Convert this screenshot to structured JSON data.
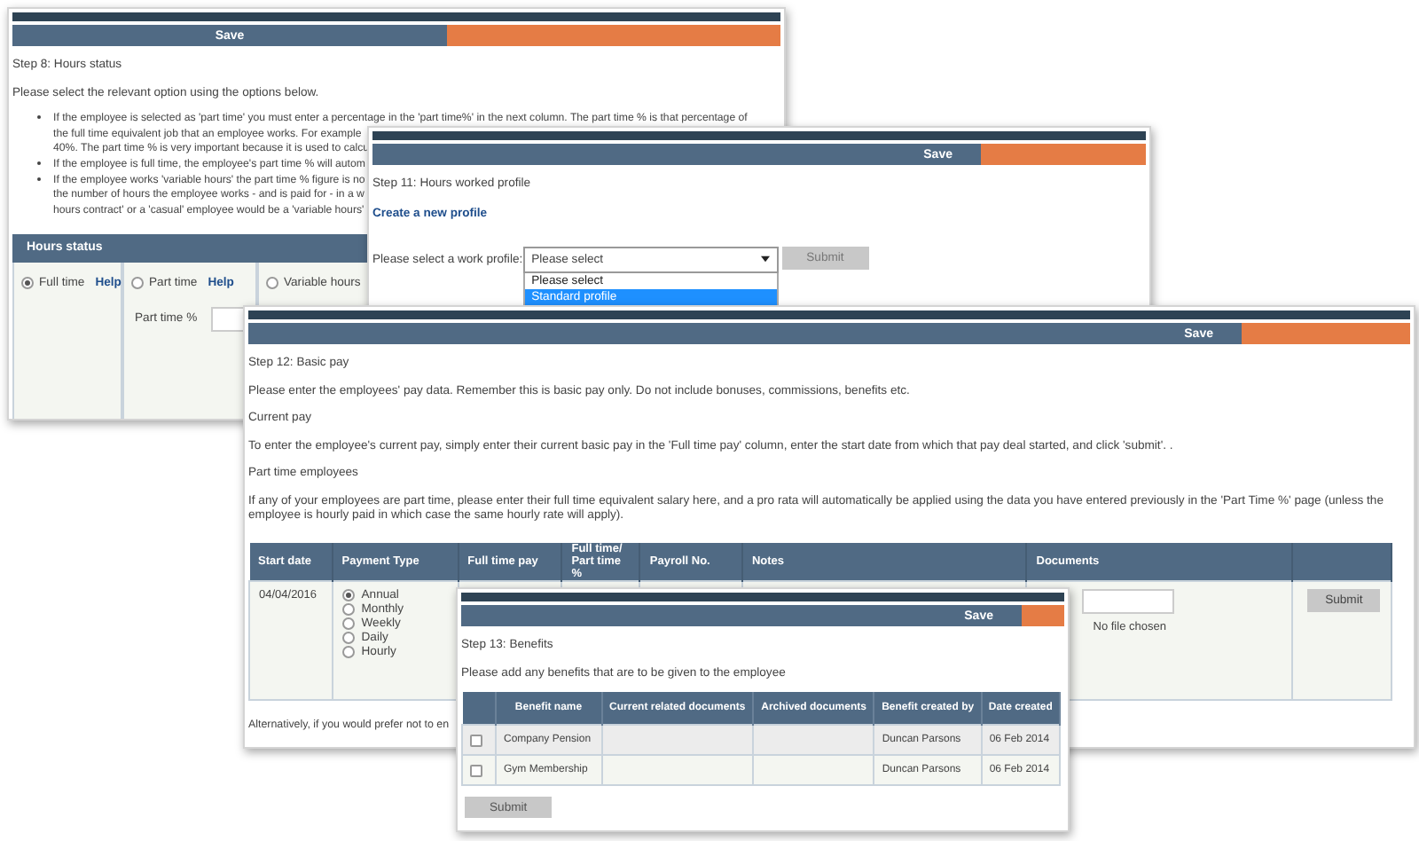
{
  "hours_status_window": {
    "save_button": "Save",
    "step": "Step 8: Hours status",
    "intro": "Please select the relevant option using the options below.",
    "lines": [
      {
        "kind": "bullet",
        "text": "If the employee is selected as 'part time' you must enter a percentage in the 'part time%' in the next column. The part time % is that percentage of"
      },
      {
        "kind": "continuation",
        "text": "the full time equivalent job that an employee works. For example"
      },
      {
        "kind": "continuation",
        "text": "40%. The part time % is very important because it is used to calcu"
      },
      {
        "kind": "bullet",
        "text": "If the employee is full time, the employee's part time % will autom"
      },
      {
        "kind": "bullet",
        "text": "If the employee works 'variable hours' the part time % figure is no"
      },
      {
        "kind": "continuation",
        "text": "the number of hours the employee works - and is paid for - in a w"
      },
      {
        "kind": "continuation",
        "text": "hours contract' or a 'casual' employee would be a 'variable hours'"
      }
    ],
    "table": {
      "heading": "Hours status",
      "options": [
        {
          "label": "Full time",
          "selected": true,
          "help": "Help"
        },
        {
          "label": "Part time",
          "selected": false,
          "help": "Help",
          "field_label": "Part time %"
        },
        {
          "label": "Variable hours",
          "selected": false
        }
      ]
    }
  },
  "hours_profile_window": {
    "save_button": "Save",
    "step": "Step 11: Hours worked profile",
    "create_link": "Create a new profile",
    "select_label": "Please select a work profile:",
    "select_value": "Please select",
    "submit_button": "Submit",
    "options": [
      {
        "label": "Please select",
        "selected": false
      },
      {
        "label": "Standard profile",
        "selected": true
      }
    ]
  },
  "basic_pay_window": {
    "save_button": "Save",
    "step": "Step 12: Basic pay",
    "paragraphs": [
      "Please enter the employees' pay data. Remember this is basic pay only. Do not include bonuses, commissions, benefits etc.",
      "Current pay",
      "To enter the employee's current pay, simply enter their current basic pay in the 'Full time pay' column, enter the start date from which that pay deal started, and click 'submit'. .",
      "Part time employees",
      "If any of your employees are part time, please enter their full time equivalent salary here, and a pro rata will automatically be applied using the data you have entered previously in the 'Part Time %' page (unless the employee is hourly paid in which case the same hourly rate will apply)."
    ],
    "table": {
      "columns": [
        "Start date",
        "Payment Type",
        "Full time pay",
        "Full time/ Part time %",
        "Payroll No.",
        "Notes",
        "Documents"
      ],
      "rows": [
        {
          "start_date": "04/04/2016",
          "payment_types": [
            {
              "label": "Annual",
              "selected": true
            },
            {
              "label": "Monthly",
              "selected": false
            },
            {
              "label": "Weekly",
              "selected": false
            },
            {
              "label": "Daily",
              "selected": false
            },
            {
              "label": "Hourly",
              "selected": false
            }
          ],
          "file_status": "No file chosen",
          "submit_button": "Submit"
        }
      ]
    },
    "footer": "Alternatively, if you would prefer not to en"
  },
  "benefits_window": {
    "save_button": "Save",
    "step": "Step 13: Benefits",
    "intro": "Please add any benefits that are to be given to the employee",
    "table": {
      "columns": [
        "Benefit name",
        "Current related documents",
        "Archived documents",
        "Benefit created by",
        "Date created"
      ],
      "rows": [
        {
          "checked": false,
          "cells": [
            "Company Pension",
            "",
            "",
            "Duncan Parsons",
            "06 Feb 2014"
          ]
        },
        {
          "checked": false,
          "cells": [
            "Gym Membership",
            "",
            "",
            "Duncan Parsons",
            "06 Feb 2014"
          ]
        }
      ]
    },
    "submit_button": "Submit"
  }
}
